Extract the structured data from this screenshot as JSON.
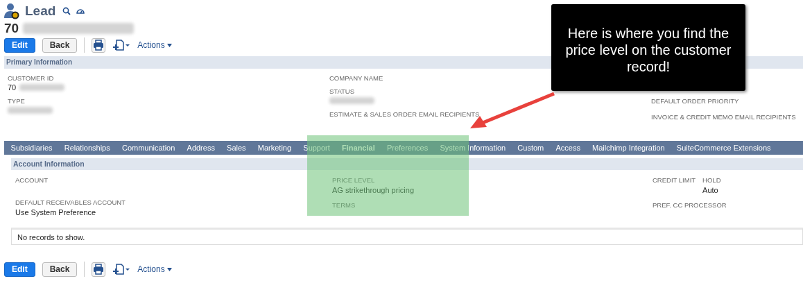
{
  "header": {
    "record_type": "Lead",
    "record_number": "70",
    "name_redacted": true
  },
  "toolbar_top": {
    "edit": "Edit",
    "back": "Back",
    "actions": "Actions"
  },
  "primary_section": {
    "title": "Primary Information",
    "columns": [
      [
        {
          "label": "CUSTOMER ID",
          "value": "70",
          "redacted": true
        },
        {
          "label": "TYPE",
          "redacted": true
        }
      ],
      [
        {
          "label": "COMPANY NAME"
        },
        {
          "label": "STATUS",
          "redacted": true
        },
        {
          "label": "ESTIMATE & SALES ORDER EMAIL RECIPIENTS"
        }
      ],
      [
        {
          "label": "DEFAULT ORDER PRIORITY"
        },
        {
          "label": "INVOICE & CREDIT MEMO EMAIL RECIPIENTS"
        }
      ]
    ]
  },
  "tabs": [
    {
      "label": "Subsidiaries",
      "selected": false
    },
    {
      "label": "Relationships",
      "selected": false
    },
    {
      "label": "Communication",
      "selected": false
    },
    {
      "label": "Address",
      "selected": false
    },
    {
      "label": "Sales",
      "selected": false
    },
    {
      "label": "Marketing",
      "selected": false
    },
    {
      "label": "Support",
      "selected": false
    },
    {
      "label": "Financial",
      "selected": true
    },
    {
      "label": "Preferences",
      "selected": false
    },
    {
      "label": "System Information",
      "selected": false
    },
    {
      "label": "Custom",
      "selected": false
    },
    {
      "label": "Access",
      "selected": false
    },
    {
      "label": "Mailchimp Integration",
      "selected": false
    },
    {
      "label": "SuiteCommerce Extensions",
      "selected": false
    }
  ],
  "account_section": {
    "title": "Account Information",
    "columns": [
      [
        {
          "fields": [
            {
              "label": "ACCOUNT"
            }
          ]
        },
        {
          "fields": [
            {
              "label": "DEFAULT RECEIVABLES ACCOUNT",
              "value": "Use System Preference"
            }
          ]
        }
      ],
      [
        {
          "fields": [
            {
              "label": "PRICE LEVEL",
              "value": "AG strikethrough pricing"
            }
          ]
        },
        {
          "fields": [
            {
              "label": "TERMS"
            }
          ]
        }
      ],
      [
        {
          "fields": [
            {
              "label": "CREDIT LIMIT"
            },
            {
              "label": "HOLD",
              "value": "Auto"
            }
          ]
        },
        {
          "fields": [
            {
              "label": "PREF. CC PROCESSOR"
            }
          ]
        }
      ]
    ]
  },
  "empty_list": "No records to show.",
  "toolbar_bottom": {
    "edit": "Edit",
    "back": "Back",
    "actions": "Actions"
  },
  "annotation": {
    "callout": "Here is where you find the price level on the customer record!",
    "highlight": true
  }
}
